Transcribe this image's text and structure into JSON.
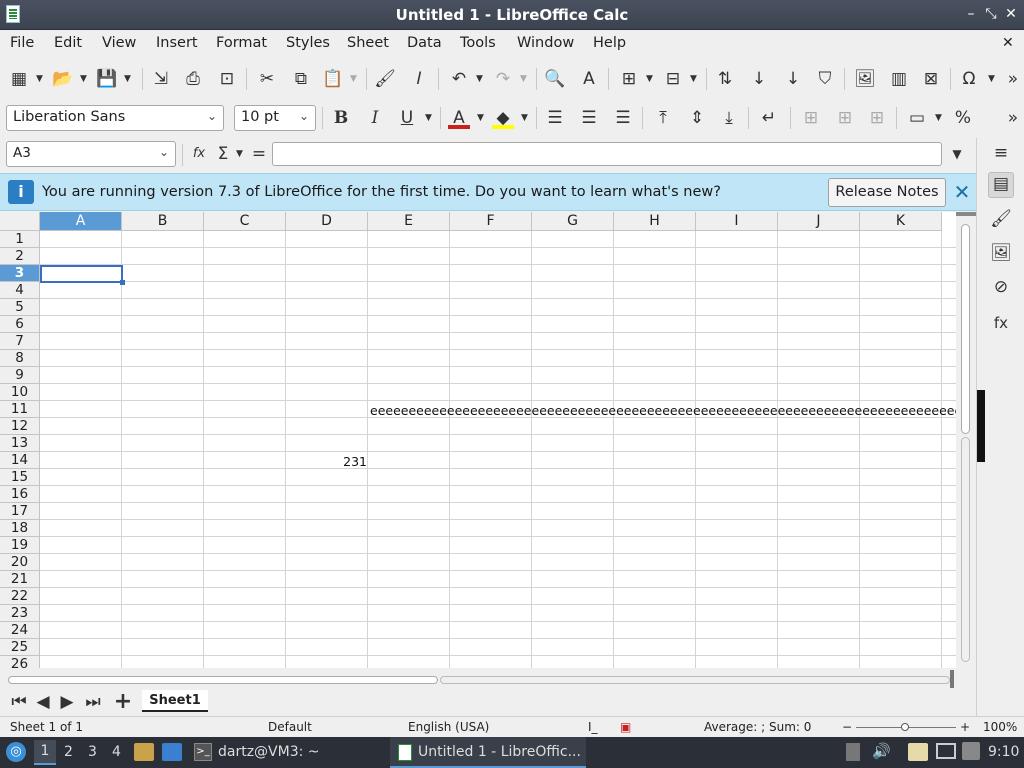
{
  "window": {
    "title": "Untitled 1 - LibreOffice Calc"
  },
  "menu": [
    "File",
    "Edit",
    "View",
    "Insert",
    "Format",
    "Styles",
    "Sheet",
    "Data",
    "Tools",
    "Window",
    "Help"
  ],
  "toolbar": {
    "font_name": "Liberation Sans",
    "font_size": "10 pt"
  },
  "formula_bar": {
    "name_box": "A3",
    "sum_symbol": "Σ",
    "equals": "=",
    "fx": "fx",
    "content": ""
  },
  "infobar": {
    "message": "You are running version 7.3 of LibreOffice for the first time. Do you want to learn what's new?",
    "button": "Release Notes"
  },
  "grid": {
    "columns": [
      "A",
      "B",
      "C",
      "D",
      "E",
      "F",
      "G",
      "H",
      "I",
      "J",
      "K"
    ],
    "rows": [
      "1",
      "2",
      "3",
      "4",
      "5",
      "6",
      "7",
      "8",
      "9",
      "10",
      "11",
      "12",
      "13",
      "14",
      "15",
      "16",
      "17",
      "18",
      "19",
      "20",
      "21",
      "22",
      "23",
      "24",
      "25",
      "26"
    ],
    "selected_cell": "A3",
    "cells": {
      "E11": "eeeeeeeeeeeeeeeeeeeeeeeeeeeeeeeeeeeeeeeeeeeeeeeeeeeeeeeeeeeeeeeeeeeeeeeeeeeeeeeeeeeeeeeeeeee",
      "D14": "231"
    }
  },
  "sheet_tabs": {
    "active": "Sheet1"
  },
  "status": {
    "sheet": "Sheet 1 of 1",
    "style": "Default",
    "language": "English (USA)",
    "summary": "Average: ; Sum: 0",
    "zoom_minus": "−",
    "zoom_plus": "+",
    "zoom": "100%"
  },
  "taskbar": {
    "workspaces": [
      "1",
      "2",
      "3",
      "4"
    ],
    "terminal": "dartz@VM3: ~",
    "calc": "Untitled 1 - LibreOffic...",
    "clock": "9:10"
  },
  "colors": {
    "selection": "#5b9bd5",
    "infobar": "#bfe5f7",
    "cursor": "#3a6ec4"
  }
}
